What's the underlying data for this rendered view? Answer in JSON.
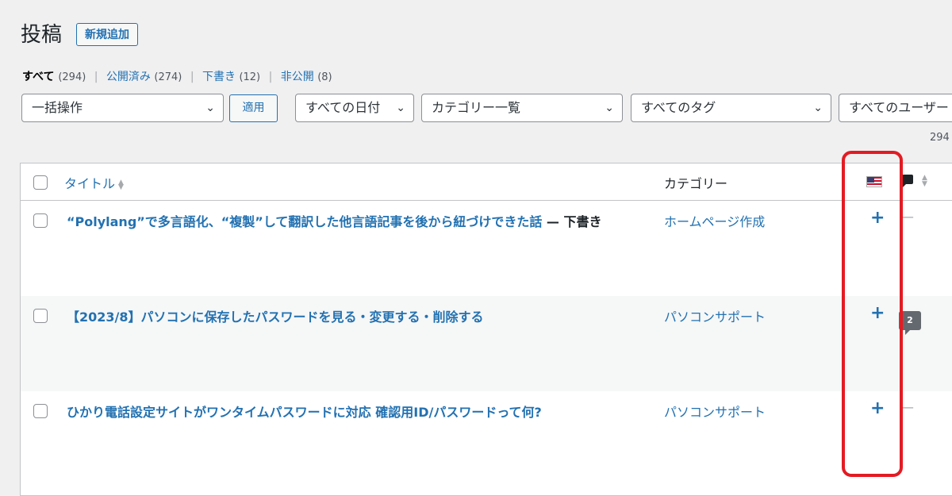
{
  "header": {
    "title": "投稿",
    "add_new_label": "新規追加"
  },
  "filters": {
    "all": {
      "label": "すべて",
      "count": "(294)"
    },
    "published": {
      "label": "公開済み",
      "count": "(274)"
    },
    "drafts": {
      "label": "下書き",
      "count": "(12)"
    },
    "private": {
      "label": "非公開",
      "count": "(8)"
    },
    "separator": "|"
  },
  "toolbar": {
    "bulk_action": "一括操作",
    "apply_label": "適用",
    "date_filter": "すべての日付",
    "category_filter": "カテゴリー一覧",
    "tag_filter": "すべてのタグ",
    "user_filter": "すべてのユーザー",
    "items_count": "294"
  },
  "table": {
    "col_title": "タイトル",
    "col_category": "カテゴリー",
    "language_flag": "us-flag-icon",
    "comments_icon": "comment-icon",
    "rows": [
      {
        "title": "“Polylang”で多言語化、“複製”して翻訳した他言語記事を後から紐づけできた話",
        "state": " — 下書き",
        "category": "ホームページ作成",
        "translation_action": "+",
        "comments": "—"
      },
      {
        "title": "【2023/8】パソコンに保存したパスワードを見る・変更する・削除する",
        "state": "",
        "category": "パソコンサポート",
        "translation_action": "+",
        "comments": "2"
      },
      {
        "title": "ひかり電話設定サイトがワンタイムパスワードに対応 確認用ID/パスワードって何?",
        "state": "",
        "category": "パソコンサポート",
        "translation_action": "+",
        "comments": "—"
      }
    ]
  },
  "colors": {
    "link": "#2271b1",
    "highlight": "#e31b23",
    "background": "#f0f0f1"
  }
}
